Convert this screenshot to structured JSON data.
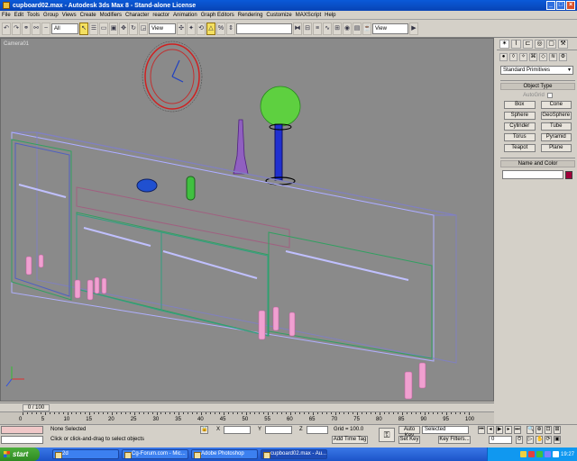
{
  "window": {
    "title": "cupboard02.max - Autodesk 3ds Max 8 - Stand-alone License"
  },
  "menu": [
    "File",
    "Edit",
    "Tools",
    "Group",
    "Views",
    "Create",
    "Modifiers",
    "Character",
    "reactor",
    "Animation",
    "Graph Editors",
    "Rendering",
    "Customize",
    "MAXScript",
    "Help"
  ],
  "toolbar": {
    "selection_filter": "All",
    "ref_coord": "View",
    "named_selection": "",
    "view_dropdown": "View"
  },
  "viewport": {
    "label": "Camera01"
  },
  "command_panel": {
    "category": "Standard Primitives",
    "object_type_title": "Object Type",
    "autogrid_label": "AutoGrid",
    "buttons": [
      "Box",
      "Cone",
      "Sphere",
      "GeoSphere",
      "Cylinder",
      "Tube",
      "Torus",
      "Pyramid",
      "Teapot",
      "Plane"
    ],
    "name_color_title": "Name and Color",
    "object_name": "",
    "object_color": "#a0003a"
  },
  "timeline": {
    "slider_label": "0 / 100",
    "ticks": [
      "0",
      "5",
      "10",
      "15",
      "20",
      "25",
      "30",
      "35",
      "40",
      "45",
      "50",
      "55",
      "60",
      "65",
      "70",
      "75",
      "80",
      "85",
      "90",
      "95",
      "100"
    ]
  },
  "status": {
    "selection": "None Selected",
    "prompt": "Click or click-and-drag to select objects",
    "x_label": "X",
    "y_label": "Y",
    "z_label": "Z",
    "grid": "Grid = 100.0",
    "add_time_tag": "Add Time Tag",
    "auto_key": "Auto Key",
    "set_key": "Set Key",
    "key_mode": "Selected",
    "key_filters": "Key Filters...",
    "frame": "0"
  },
  "taskbar": {
    "start": "start",
    "tasks": [
      "2d",
      "Cg-Forum.com - Mic...",
      "Adobe Photoshop",
      "cupboard02.max - Au..."
    ],
    "clock": "19:27"
  }
}
